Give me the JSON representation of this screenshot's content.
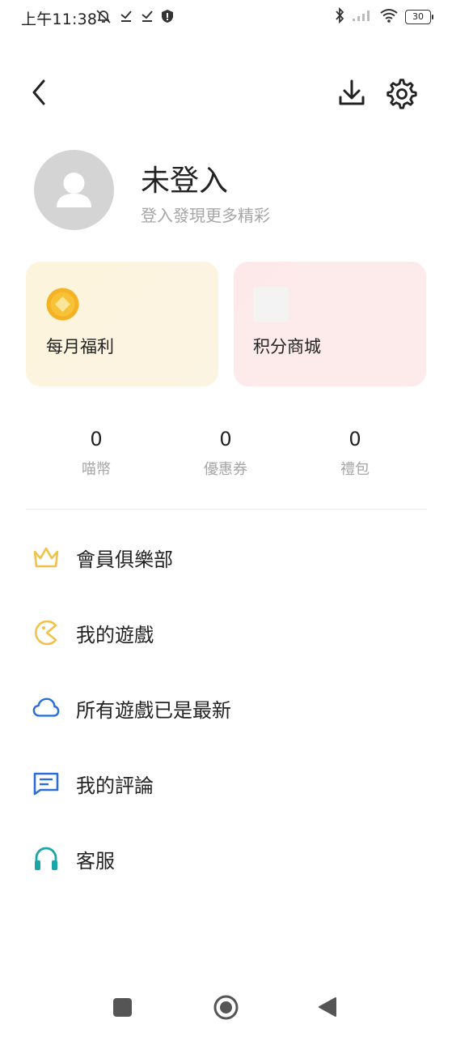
{
  "status_bar": {
    "time": "上午11:38",
    "battery": "30",
    "icons": [
      "alarm-off-icon",
      "download-done-icon",
      "download-done-icon",
      "shield-icon",
      "bluetooth-icon",
      "signal-icon",
      "wifi-icon"
    ]
  },
  "header": {
    "icons": [
      "back-icon",
      "download-icon",
      "gear-icon"
    ]
  },
  "profile": {
    "title": "未登入",
    "subtitle": "登入發現更多精彩"
  },
  "cards": [
    {
      "label": "每月福利",
      "icon": "coin-icon"
    },
    {
      "label": "积分商城",
      "icon": "shop-icon"
    }
  ],
  "stats": [
    {
      "value": "0",
      "label": "喵幣"
    },
    {
      "value": "0",
      "label": "優惠券"
    },
    {
      "value": "0",
      "label": "禮包"
    }
  ],
  "menu": [
    {
      "label": "會員俱樂部",
      "icon": "crown-icon",
      "color": "#f2c14a"
    },
    {
      "label": "我的遊戲",
      "icon": "pacman-icon",
      "color": "#f2c14a"
    },
    {
      "label": "所有遊戲已是最新",
      "icon": "cloud-icon",
      "color": "#2b6fd6"
    },
    {
      "label": "我的評論",
      "icon": "comment-icon",
      "color": "#2b6fd6"
    },
    {
      "label": "客服",
      "icon": "headset-icon",
      "color": "#1aa6a8"
    }
  ],
  "nav_bar": {
    "icons": [
      "recent-apps-icon",
      "home-icon",
      "back-triangle-icon"
    ]
  }
}
